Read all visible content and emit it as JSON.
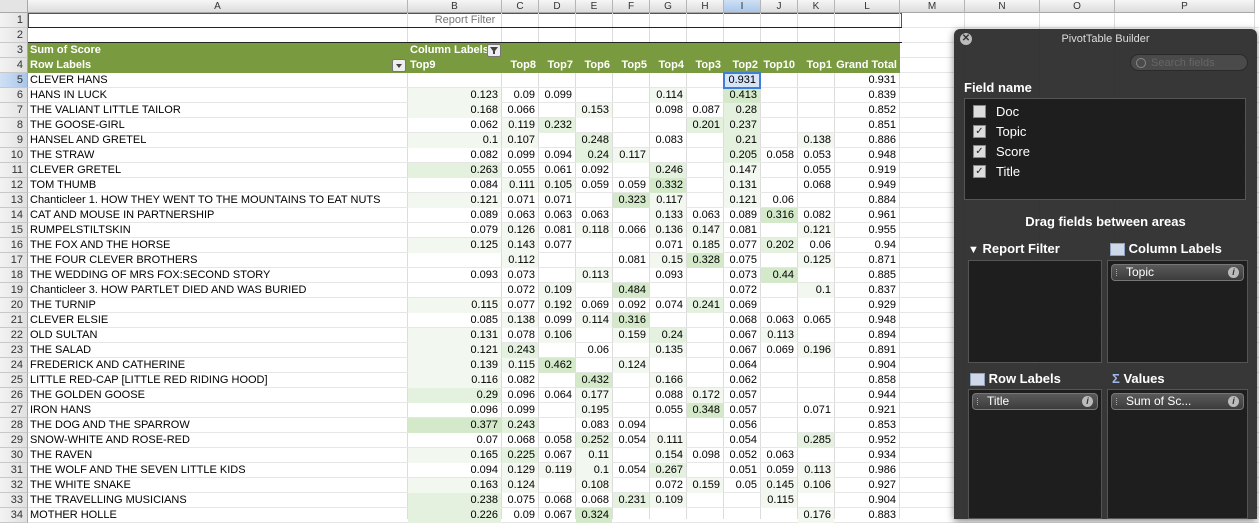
{
  "columns": [
    {
      "letter": "A",
      "w": 380
    },
    {
      "letter": "B",
      "w": 94
    },
    {
      "letter": "C",
      "w": 37
    },
    {
      "letter": "D",
      "w": 37
    },
    {
      "letter": "E",
      "w": 37
    },
    {
      "letter": "F",
      "w": 37
    },
    {
      "letter": "G",
      "w": 37
    },
    {
      "letter": "H",
      "w": 37
    },
    {
      "letter": "I",
      "w": 37
    },
    {
      "letter": "J",
      "w": 37
    },
    {
      "letter": "K",
      "w": 37
    },
    {
      "letter": "L",
      "w": 65
    },
    {
      "letter": "M",
      "w": 65
    },
    {
      "letter": "N",
      "w": 75
    },
    {
      "letter": "O",
      "w": 75
    },
    {
      "letter": "P",
      "w": 140
    }
  ],
  "selected_column": "I",
  "selected_row": "5",
  "report_filter_label": "Report Filter",
  "pivot": {
    "value_label": "Sum of Score",
    "column_labels": "Column Labels",
    "row_labels": "Row Labels",
    "headers": [
      "Top9",
      "Top8",
      "Top7",
      "Top6",
      "Top5",
      "Top4",
      "Top3",
      "Top2",
      "Top10",
      "Top1",
      "Grand Total"
    ],
    "rows": [
      {
        "num": "5",
        "name": "CLEVER HANS",
        "v": [
          "",
          "",
          "",
          "",
          "",
          "",
          "",
          "0.931",
          "",
          "",
          ""
        ],
        "gt": "0.931"
      },
      {
        "num": "6",
        "name": "HANS IN LUCK",
        "v": [
          "0.123",
          "0.09",
          "0.099",
          "",
          "",
          "0.114",
          "",
          "0.413",
          "",
          "",
          ""
        ],
        "gt": "0.839"
      },
      {
        "num": "7",
        "name": "THE VALIANT LITTLE TAILOR",
        "v": [
          "0.168",
          "0.066",
          "",
          "0.153",
          "",
          "0.098",
          "0.087",
          "0.28",
          "",
          "",
          ""
        ],
        "gt": "0.852"
      },
      {
        "num": "8",
        "name": "THE GOOSE-GIRL",
        "v": [
          "0.062",
          "0.119",
          "0.232",
          "",
          "",
          "",
          "0.201",
          "0.237",
          "",
          "",
          ""
        ],
        "gt": "0.851"
      },
      {
        "num": "9",
        "name": "HANSEL AND GRETEL",
        "v": [
          "0.1",
          "0.107",
          "",
          "0.248",
          "",
          "0.083",
          "",
          "0.21",
          "",
          "0.138",
          ""
        ],
        "gt": "0.886"
      },
      {
        "num": "10",
        "name": "THE STRAW",
        "v": [
          "0.082",
          "0.099",
          "0.094",
          "0.24",
          "0.117",
          "",
          "",
          "0.205",
          "0.058",
          "0.053",
          ""
        ],
        "gt": "0.948"
      },
      {
        "num": "11",
        "name": "CLEVER GRETEL",
        "v": [
          "0.263",
          "0.055",
          "0.061",
          "0.092",
          "",
          "0.246",
          "",
          "0.147",
          "",
          "0.055",
          ""
        ],
        "gt": "0.919"
      },
      {
        "num": "12",
        "name": "TOM THUMB",
        "v": [
          "0.084",
          "0.111",
          "0.105",
          "0.059",
          "0.059",
          "0.332",
          "",
          "0.131",
          "",
          "0.068",
          ""
        ],
        "gt": "0.949"
      },
      {
        "num": "13",
        "name": "Chanticleer 1. HOW THEY WENT TO THE MOUNTAINS TO EAT NUTS",
        "v": [
          "0.121",
          "0.071",
          "0.071",
          "",
          "0.323",
          "0.117",
          "",
          "0.121",
          "0.06",
          "",
          ""
        ],
        "gt": "0.884"
      },
      {
        "num": "14",
        "name": "CAT AND MOUSE IN PARTNERSHIP",
        "v": [
          "0.089",
          "0.063",
          "0.063",
          "0.063",
          "",
          "0.133",
          "0.063",
          "0.089",
          "0.316",
          "0.082",
          ""
        ],
        "gt": "0.961"
      },
      {
        "num": "15",
        "name": "RUMPELSTILTSKIN",
        "v": [
          "0.079",
          "0.126",
          "0.081",
          "0.118",
          "0.066",
          "0.136",
          "0.147",
          "0.081",
          "",
          "0.121",
          ""
        ],
        "gt": "0.955"
      },
      {
        "num": "16",
        "name": "THE FOX AND THE HORSE",
        "v": [
          "0.125",
          "0.143",
          "0.077",
          "",
          "",
          "0.071",
          "0.185",
          "0.077",
          "0.202",
          "0.06",
          ""
        ],
        "gt": "0.94"
      },
      {
        "num": "17",
        "name": "THE FOUR CLEVER BROTHERS",
        "v": [
          "",
          "0.112",
          "",
          "",
          "0.081",
          "0.15",
          "0.328",
          "0.075",
          "",
          "0.125",
          ""
        ],
        "gt": "0.871"
      },
      {
        "num": "18",
        "name": "THE WEDDING OF MRS FOX:SECOND STORY",
        "v": [
          "0.093",
          "0.073",
          "",
          "0.113",
          "",
          "0.093",
          "",
          "0.073",
          "0.44",
          "",
          ""
        ],
        "gt": "0.885"
      },
      {
        "num": "19",
        "name": "Chanticleer 3. HOW PARTLET DIED AND WAS BURIED",
        "v": [
          "",
          "0.072",
          "0.109",
          "",
          "0.484",
          "",
          "",
          "0.072",
          "",
          "0.1",
          ""
        ],
        "gt": "0.837"
      },
      {
        "num": "20",
        "name": "THE TURNIP",
        "v": [
          "0.115",
          "0.077",
          "0.192",
          "0.069",
          "0.092",
          "0.074",
          "0.241",
          "0.069",
          "",
          "",
          ""
        ],
        "gt": "0.929"
      },
      {
        "num": "21",
        "name": "CLEVER ELSIE",
        "v": [
          "0.085",
          "0.138",
          "0.099",
          "0.114",
          "0.316",
          "",
          "",
          "0.068",
          "0.063",
          "0.065",
          ""
        ],
        "gt": "0.948"
      },
      {
        "num": "22",
        "name": "OLD SULTAN",
        "v": [
          "0.131",
          "0.078",
          "0.106",
          "",
          "0.159",
          "0.24",
          "",
          "0.067",
          "0.113",
          "",
          ""
        ],
        "gt": "0.894"
      },
      {
        "num": "23",
        "name": "THE SALAD",
        "v": [
          "0.121",
          "0.243",
          "",
          "0.06",
          "",
          "0.135",
          "",
          "0.067",
          "0.069",
          "0.196",
          ""
        ],
        "gt": "0.891"
      },
      {
        "num": "24",
        "name": "FREDERICK AND CATHERINE",
        "v": [
          "0.139",
          "0.115",
          "0.462",
          "",
          "0.124",
          "",
          "",
          "0.064",
          "",
          "",
          ""
        ],
        "gt": "0.904"
      },
      {
        "num": "25",
        "name": "LITTLE RED-CAP [LITTLE RED RIDING HOOD]",
        "v": [
          "0.116",
          "0.082",
          "",
          "0.432",
          "",
          "0.166",
          "",
          "0.062",
          "",
          "",
          ""
        ],
        "gt": "0.858"
      },
      {
        "num": "26",
        "name": "THE GOLDEN GOOSE",
        "v": [
          "0.29",
          "0.096",
          "0.064",
          "0.177",
          "",
          "0.088",
          "0.172",
          "0.057",
          "",
          "",
          ""
        ],
        "gt": "0.944"
      },
      {
        "num": "27",
        "name": "IRON HANS",
        "v": [
          "0.096",
          "0.099",
          "",
          "0.195",
          "",
          "0.055",
          "0.348",
          "0.057",
          "",
          "0.071",
          ""
        ],
        "gt": "0.921"
      },
      {
        "num": "28",
        "name": "THE DOG AND THE SPARROW",
        "v": [
          "0.377",
          "0.243",
          "",
          "0.083",
          "0.094",
          "",
          "",
          "0.056",
          "",
          "",
          ""
        ],
        "gt": "0.853"
      },
      {
        "num": "29",
        "name": "SNOW-WHITE AND ROSE-RED",
        "v": [
          "0.07",
          "0.068",
          "0.058",
          "0.252",
          "0.054",
          "0.111",
          "",
          "0.054",
          "",
          "0.285",
          ""
        ],
        "gt": "0.952"
      },
      {
        "num": "30",
        "name": "THE RAVEN",
        "v": [
          "0.165",
          "0.225",
          "0.067",
          "0.11",
          "",
          "0.154",
          "0.098",
          "0.052",
          "0.063",
          "",
          ""
        ],
        "gt": "0.934"
      },
      {
        "num": "31",
        "name": "THE WOLF AND THE SEVEN LITTLE KIDS",
        "v": [
          "0.094",
          "0.129",
          "0.119",
          "0.1",
          "0.054",
          "0.267",
          "",
          "0.051",
          "0.059",
          "0.113",
          ""
        ],
        "gt": "0.986"
      },
      {
        "num": "32",
        "name": "THE WHITE SNAKE",
        "v": [
          "0.163",
          "0.124",
          "",
          "0.108",
          "",
          "0.072",
          "0.159",
          "0.05",
          "0.145",
          "0.106",
          ""
        ],
        "gt": "0.927"
      },
      {
        "num": "33",
        "name": "THE TRAVELLING MUSICIANS",
        "v": [
          "0.238",
          "0.075",
          "0.068",
          "0.068",
          "0.231",
          "0.109",
          "",
          "",
          "0.115",
          "",
          ""
        ],
        "gt": "0.904"
      },
      {
        "num": "34",
        "name": "MOTHER HOLLE",
        "v": [
          "0.226",
          "0.09",
          "0.067",
          "0.324",
          "",
          "",
          "",
          "",
          "",
          "0.176",
          ""
        ],
        "gt": "0.883"
      }
    ]
  },
  "builder": {
    "title": "PivotTable Builder",
    "close_label": "✕",
    "search_placeholder": "Search fields",
    "field_name_label": "Field name",
    "fields": [
      {
        "name": "Doc",
        "checked": false,
        "mark": ""
      },
      {
        "name": "Topic",
        "checked": true,
        "mark": "✓"
      },
      {
        "name": "Score",
        "checked": true,
        "mark": "✓"
      },
      {
        "name": "Title",
        "checked": true,
        "mark": "✓"
      }
    ],
    "drag_label": "Drag fields between areas",
    "report_filter": "Report Filter",
    "column_labels": "Column Labels",
    "row_labels": "Row Labels",
    "values": "Values",
    "column_field": "Topic",
    "row_field": "Title",
    "value_field": "Sum of Sc...",
    "info_glyph": "i"
  }
}
